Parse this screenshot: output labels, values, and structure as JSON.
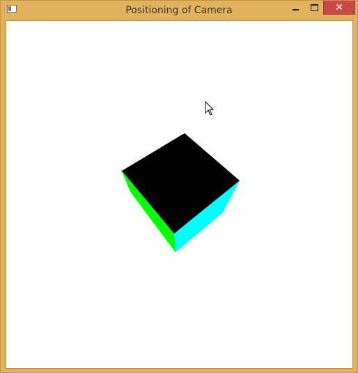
{
  "window": {
    "title": "Positioning of Camera",
    "controls": {
      "minimize_icon": "minimize-icon",
      "maximize_icon": "maximize-icon",
      "close_icon": "close-icon",
      "close_glyph": "✕"
    },
    "frame_color": "#e1b35f",
    "close_color": "#c74a46"
  },
  "viewport": {
    "background": "#ffffff",
    "cube": {
      "top_face_color": "#000000",
      "left_face_color": "#00ff00",
      "right_face_color": "#00ffff"
    },
    "cursor": "arrow-cursor-icon"
  }
}
